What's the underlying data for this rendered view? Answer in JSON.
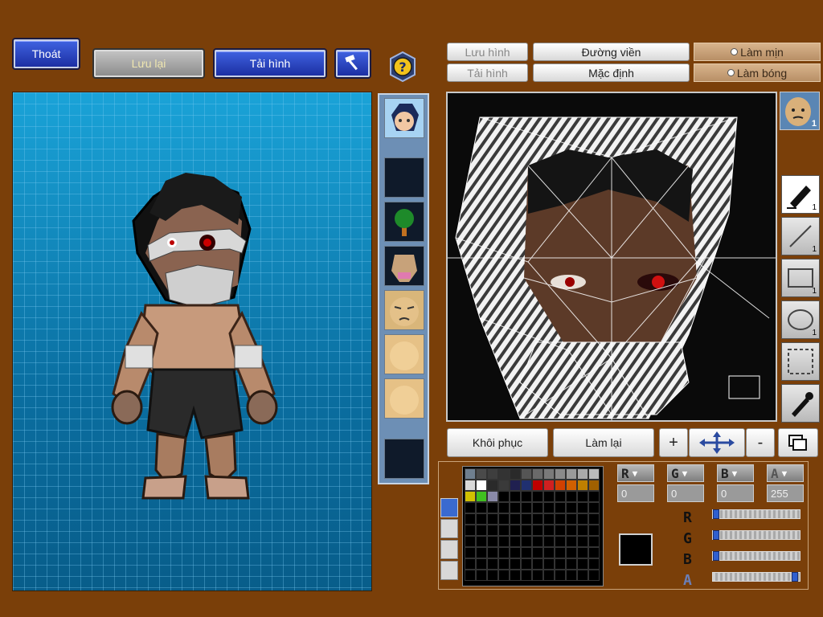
{
  "top_buttons": {
    "exit": "Thoát",
    "save": "Lưu lại",
    "load": "Tải hình"
  },
  "texture_toolbar": {
    "save_image": "Lưu hình",
    "load_image": "Tải hình",
    "outline": "Đường viền",
    "default": "Mặc định",
    "smooth": "Làm mịn",
    "shading": "Làm bóng"
  },
  "bottom_actions": {
    "restore": "Khôi phục",
    "redo": "Làm lại",
    "zoom_in": "+",
    "zoom_out": "-"
  },
  "layer_count": "1",
  "tools": [
    {
      "name": "pen",
      "count": "1"
    },
    {
      "name": "line",
      "count": "1"
    },
    {
      "name": "rect",
      "count": "1"
    },
    {
      "name": "ellipse",
      "count": "1"
    }
  ],
  "color": {
    "r_label": "R",
    "g_label": "G",
    "b_label": "B",
    "a_label": "A",
    "r": "0",
    "g": "0",
    "b": "0",
    "a": "255",
    "current": "#000000",
    "r_fraction": 0,
    "g_fraction": 0,
    "b_fraction": 0,
    "a_fraction": 1
  },
  "palette_swatches": [
    "#6f7f8f",
    "#4a4a4a",
    "#3e3e3e",
    "#333333",
    "#2a2a2a",
    "#555555",
    "#6a6a6a",
    "#7a7a7a",
    "#8a8a8a",
    "#9a9a9a",
    "#aaaaaa",
    "#bcbcbc",
    "#d9d9d9",
    "#ffffff",
    "#2a2a2a",
    "#3a3a3a",
    "#202050",
    "#203070",
    "#c00000",
    "#d02020",
    "#d04000",
    "#d06000",
    "#c08000",
    "#a06000",
    "#d0c000",
    "#40c020",
    "#8a8aa8"
  ],
  "accent": {
    "background": "#7a3f09",
    "blue_button": "#2a45c8",
    "grid": "#0d85b8"
  }
}
